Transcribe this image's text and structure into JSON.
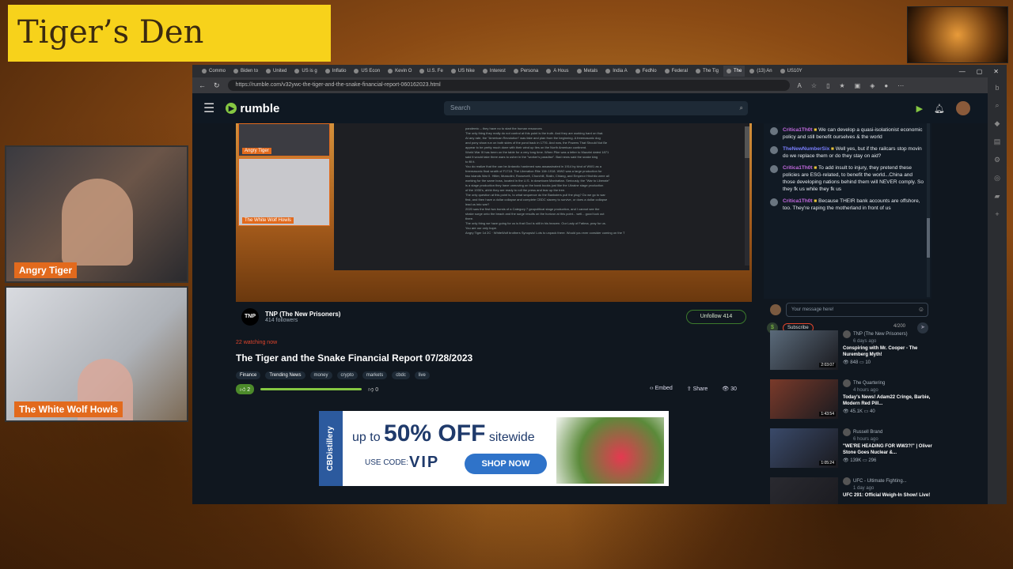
{
  "overlay": {
    "title": "Tiger’s Den",
    "cam1_label": "Angry Tiger",
    "cam2_label": "The White Wolf Howls"
  },
  "browser": {
    "tabs": [
      "Commo",
      "Biden to",
      "United",
      "US is g",
      "Inflatio",
      "US Econ",
      "Kevin O",
      "U.S. Fe",
      "US hike",
      "Interest",
      "Persona",
      "A Hous",
      "Metals",
      "India A",
      "FedNo",
      "Federal",
      "The Tig",
      "The",
      "(13) An",
      "US10Y"
    ],
    "active_tab": 17,
    "url": "https://rumble.com/v32ywc-the-tiger-and-the-snake-financial-report-060162023.html"
  },
  "rumble": {
    "logo_text": "rumble",
    "search_placeholder": "Search"
  },
  "video": {
    "cam1_label": "Angry Tiger",
    "cam2_label": "The White Wolf Howls",
    "doc_lines": [
      "pandemic – they have no to start the human resources",
      "The only thing they really do not control at this point is the truth. And they are working hard on that.",
      "At any rate, the \"American Revolution\" was fake and plan from the beginning. A freemasonic dog",
      "and pony show run on both sides of the pond back in 1776. And now, the Powers That Should Not Be",
      "appear to be pretty much done with their wind up ties on the North American continent.",
      "World War III has been on the table for a very long time. When Pike was a letter to Mazzini dated 1871",
      "said it would take three wars to usher in the \"worker's paradise\". Bad news said the snake king",
      "to fill it.",
      "You do realize that the can be Antarctic hardened was assassinated in 1914 by kind of WW1 as a",
      "freemasonic final wraith of F1718. The Liberation Rite 11th 1918. WW2 was a large production for",
      "two islands War II. Hitler, Mussolini, Roosevelt, Churchill, Stalin, Chiang, and Emperor Hirohito were all",
      "working for the same boss, located in the U.S. in downtown Manhattan. Seriously, the \"War to Liberate\"",
      "is a stage production they have unmoving on the bank books just like the Ukraine stage production",
      "of the 1930's, ahhh they are ready to roll the press and tear up the tree.",
      "The only question at this point is, to what sequence do the Banksters pull the plug? Do we go to war",
      "first, and then have a dollar collapse and complete CBDC slavery to survive, or does a dollar collapse",
      "lead us into war?",
      "2020 saw the first two bursts of a Category 7 geopolitical stage production, and I cannot see the",
      "shake surge onto the beach and the surge results on the horizon at this point... well... good luck out",
      "there.",
      "The only thing we have going for us is that God is still in his heaven. Our Lady of Fatima, pray for us.",
      "You are our only hope.",
      "Angry Tiger  1d 2C  · WhiteWolf brothers Synopsis! Lots to unpack there. Would you ever consider coming on the T"
    ]
  },
  "channel": {
    "logo": "TNP",
    "name": "TNP (The New Prisoners)",
    "followers": "414 followers",
    "unfollow_label": "Unfollow",
    "unfollow_count": "414"
  },
  "meta": {
    "watching": "22 watching now",
    "title": "The Tiger and the Snake Financial Report 07/28/2023",
    "tags": [
      "Finance",
      "Trending News",
      "money",
      "crypto",
      "markets",
      "cbdc",
      "live"
    ],
    "likes": "2",
    "dislikes": "0",
    "embed": "Embed",
    "share": "Share",
    "views": "30"
  },
  "ad": {
    "side": "CBDistillery",
    "up_to": "up to",
    "discount": "50% OFF",
    "sitewide": "sitewide",
    "code_label": "USE CODE:",
    "code": "VIP",
    "cta": "SHOP NOW"
  },
  "chat": {
    "messages": [
      {
        "user": "Critica1Th0t",
        "text": "We can develop a quasi-isolationist economic policy and still benefit ourselves & the world",
        "color": "#c46ae0"
      },
      {
        "user": "TheNewNumberSix",
        "text": "Well yes, but if the railcars stop movin do we replace them or do they stay on aid?",
        "color": "#7a7fff"
      },
      {
        "user": "Critica1Th0t",
        "text": "To add insult to injury, they pretend these policies are ESG-related, to benefit the world...China and those developing nations behind them will NEVER comply. So they fk us while they fk us",
        "color": "#c46ae0"
      },
      {
        "user": "Critica1Th0t",
        "text": "Because THEIR bank accounts are offshore, too. They're raping the motherland in front of us",
        "color": "#c46ae0"
      }
    ],
    "input_placeholder": "Your message here!",
    "subscribe_label": "Subscribe",
    "char_count": "4/200"
  },
  "recommendations": [
    {
      "channel": "TNP (The New Prisoners)",
      "age": "6 days ago",
      "title": "Conspiring with Mr. Cooper - The Nuremberg Myth!",
      "views": "848",
      "comments": "10",
      "duration": "2:03:07",
      "color": "#5a6a7a"
    },
    {
      "channel": "The Quartering",
      "age": "4 hours ago",
      "title": "Today's News! Adam22 Cringe, Barbie, Modern Red Pill...",
      "views": "45.1K",
      "comments": "40",
      "duration": "1:43:54",
      "color": "#7a3a2a"
    },
    {
      "channel": "Russell Brand",
      "age": "6 hours ago",
      "title": "\"WE'RE HEADING FOR WW3?!\" | Oliver Stone Goes Nuclear &...",
      "views": "139K",
      "comments": "296",
      "duration": "1:05:24",
      "color": "#3a4a6a"
    },
    {
      "channel": "UFC - Ultimate Fighting...",
      "age": "1 day ago",
      "title": "UFC 291: Official Weigh-In Show! Live!",
      "views": "",
      "comments": "",
      "duration": "",
      "color": "#2a2a30"
    }
  ]
}
